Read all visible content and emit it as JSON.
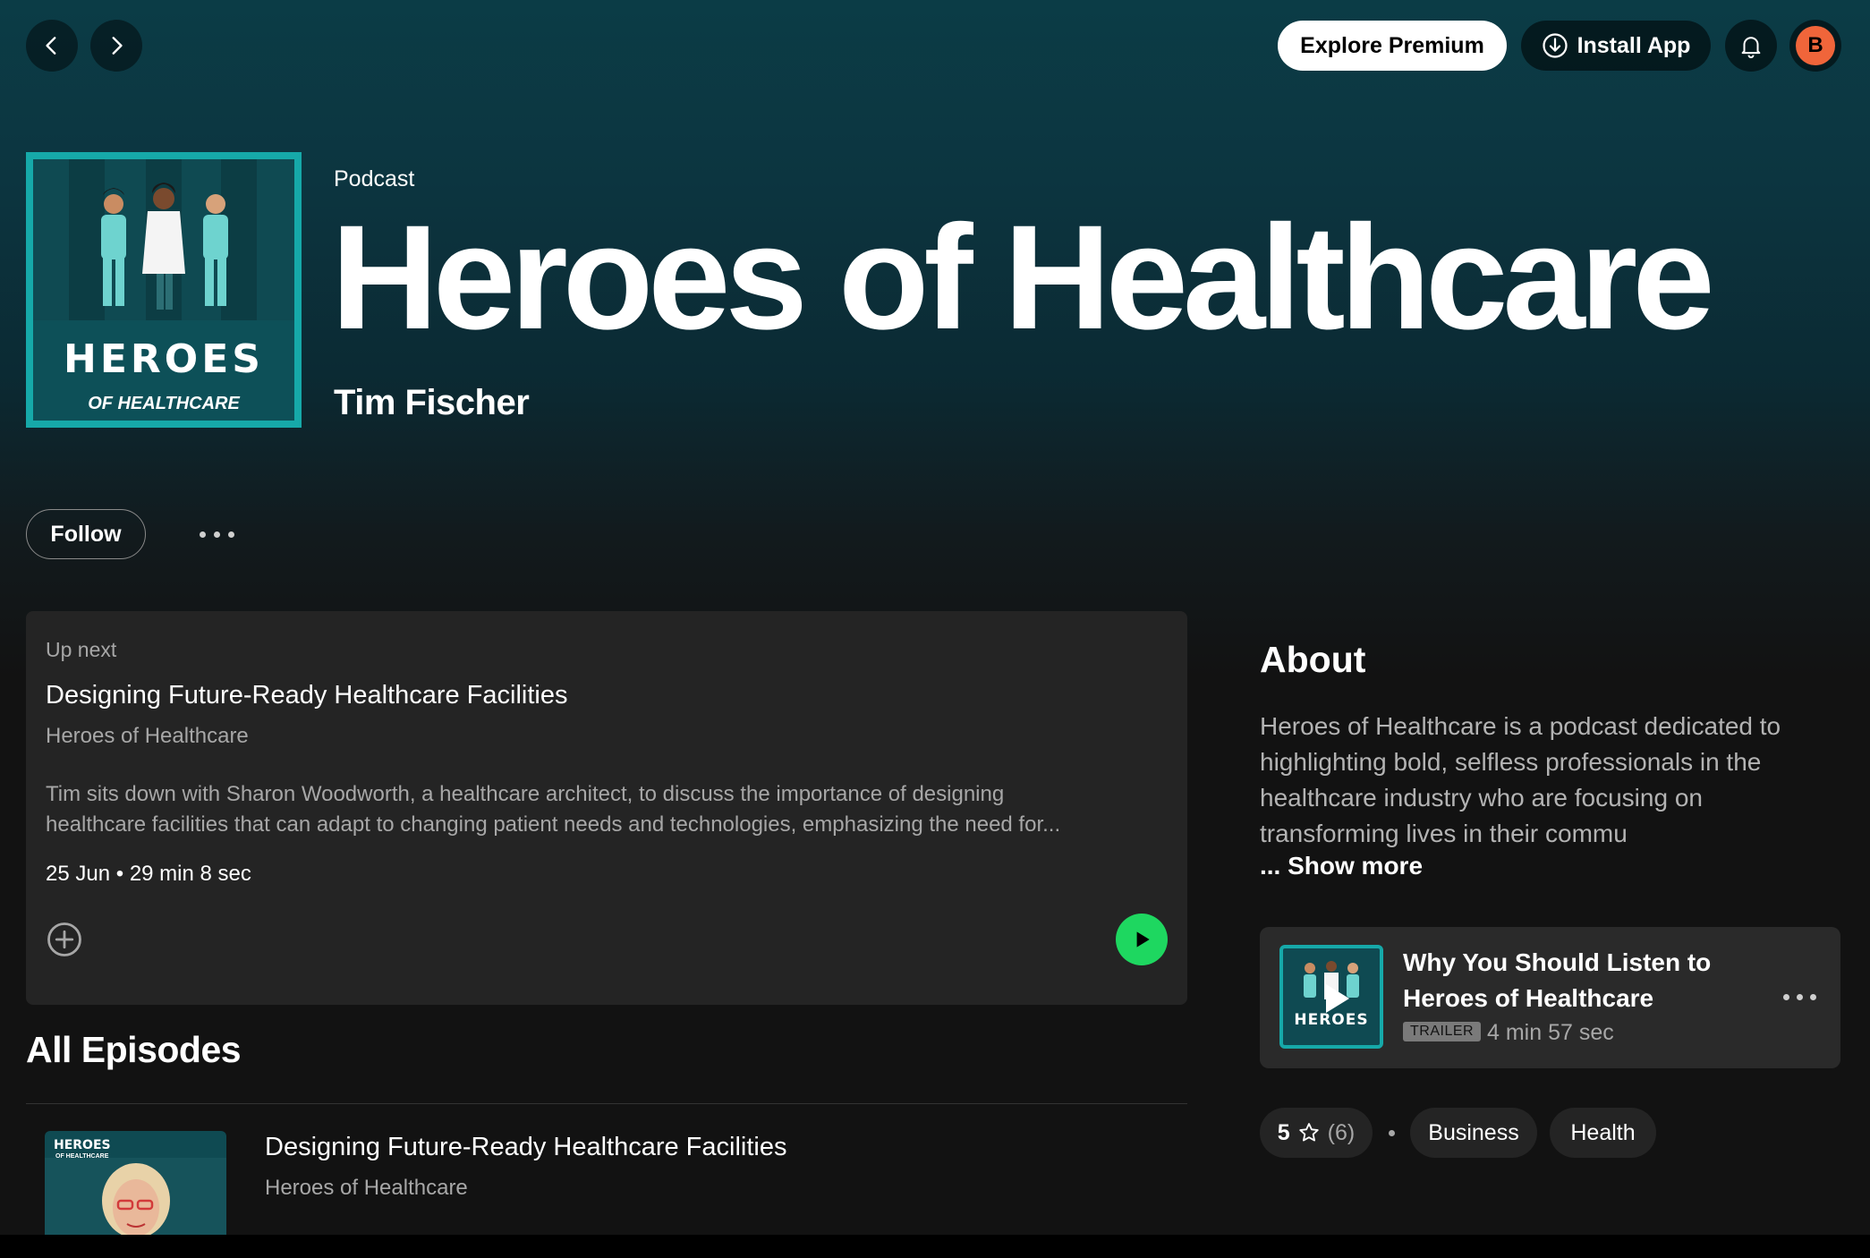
{
  "header": {
    "back_icon": "chevron-left-icon",
    "forward_icon": "chevron-right-icon",
    "explore_premium_label": "Explore Premium",
    "install_app_label": "Install App",
    "install_icon": "download-circle-icon",
    "notifications_icon": "bell-icon",
    "avatar_initial": "B",
    "avatar_color": "#f0653a"
  },
  "podcast": {
    "type_label": "Podcast",
    "title": "Heroes of Healthcare",
    "author": "Tim Fischer",
    "cover_title": "HEROES",
    "cover_subtitle": "OF HEALTHCARE",
    "cover_border_color": "#16a9a9",
    "header_color": "#0b3c46"
  },
  "actions": {
    "follow_label": "Follow",
    "more_icon": "more-horizontal-icon"
  },
  "up_next": {
    "label": "Up next",
    "title": "Designing Future-Ready Healthcare Facilities",
    "show": "Heroes of Healthcare",
    "description": "Tim sits down with Sharon Woodworth, a healthcare architect, to discuss the importance of designing\nhealthcare facilities that can adapt to changing patient needs and technologies, emphasizing the need for...",
    "date": "25 Jun",
    "duration": "29 min 8 sec",
    "add_icon": "plus-circle-icon",
    "play_icon": "play-icon",
    "play_color": "#1ed760"
  },
  "all_episodes": {
    "heading": "All Episodes",
    "episodes": [
      {
        "title": "Designing Future-Ready Healthcare Facilities",
        "show": "Heroes of Healthcare",
        "thumb_title": "HEROES",
        "thumb_subtitle": "OF HEALTHCARE"
      }
    ]
  },
  "about": {
    "heading": "About",
    "text": "Heroes of Healthcare is a podcast dedicated to highlighting bold, selfless professionals in the healthcare industry who are focusing on transforming lives in their commu",
    "show_more_label": "... Show more",
    "trailer": {
      "title": "Why You Should Listen to Heroes of Healthcare",
      "badge": "TRAILER",
      "duration": "4 min 57 sec",
      "thumb_title": "HEROES"
    },
    "rating": {
      "value": "5",
      "count": "(6)",
      "star_icon": "star-outline-icon"
    },
    "tags": [
      "Business",
      "Health"
    ]
  }
}
